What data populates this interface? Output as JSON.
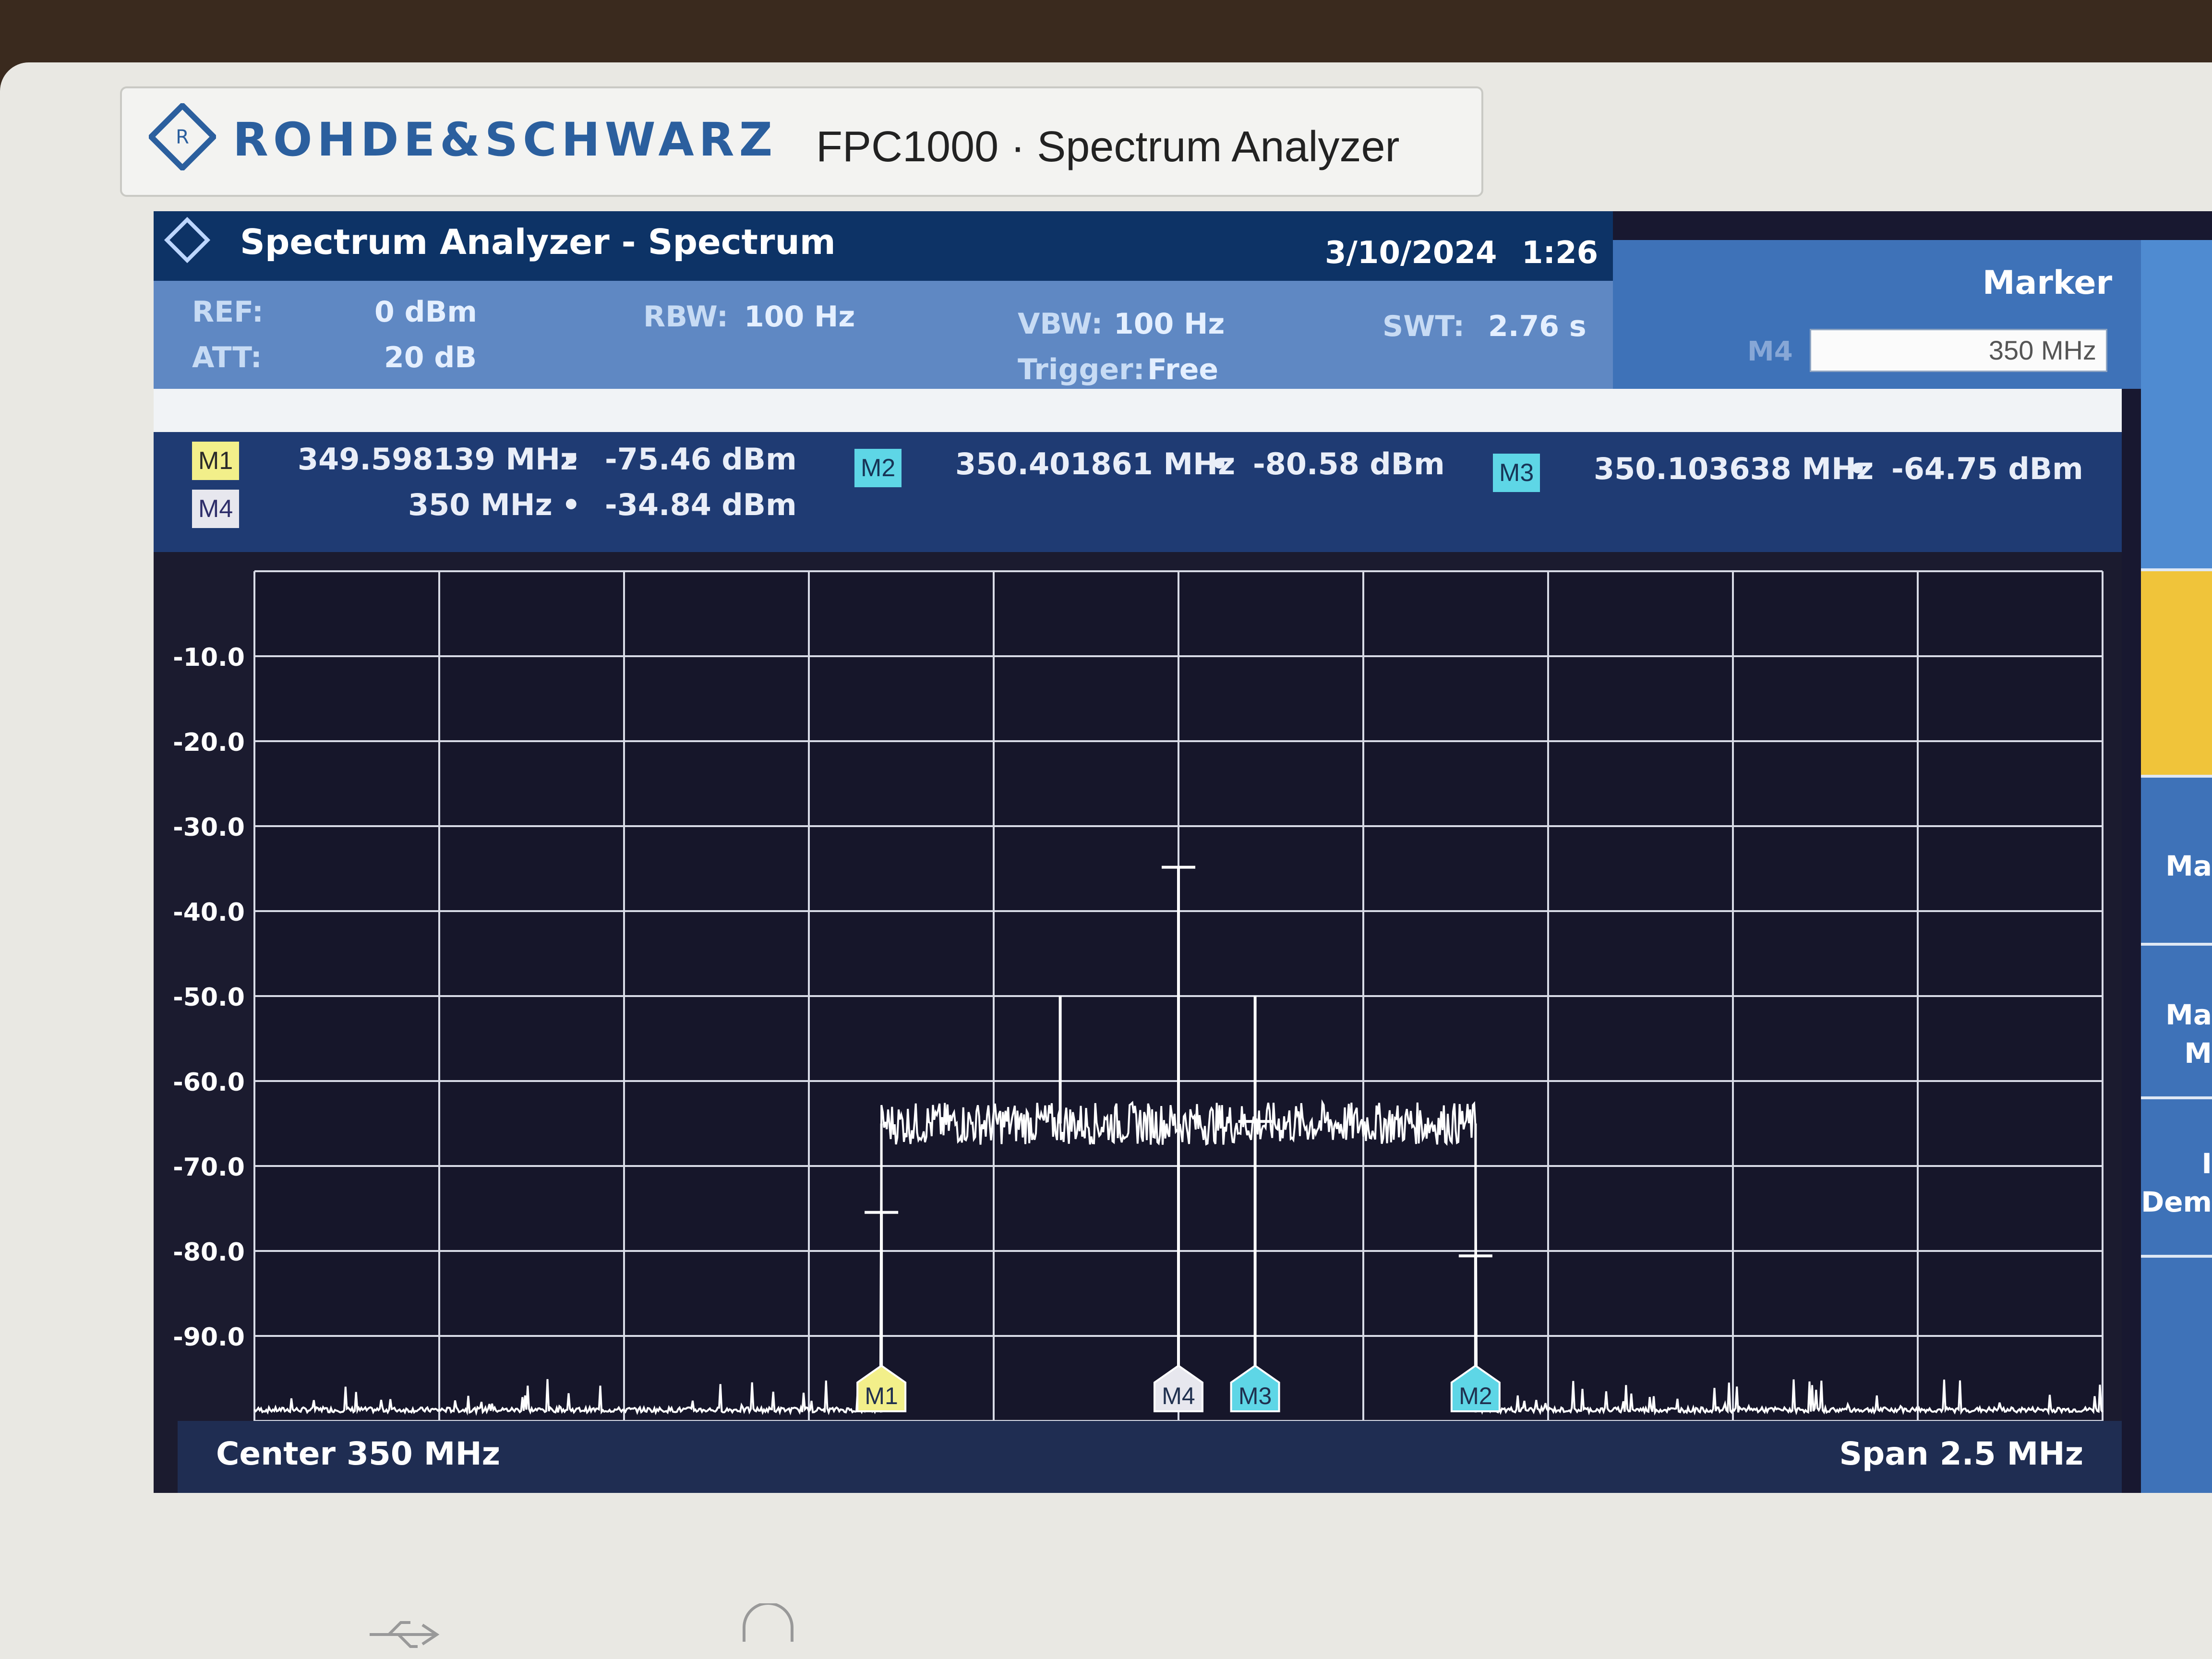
{
  "device": {
    "brand": "ROHDE&SCHWARZ",
    "model": "FPC1000 · Spectrum Analyzer"
  },
  "header": {
    "title": "Spectrum Analyzer - Spectrum",
    "date": "3/10/2024",
    "time": "1:26"
  },
  "settings": {
    "ref_label": "REF:",
    "ref_value": "0 dBm",
    "att_label": "ATT:",
    "att_value": "20 dB",
    "rbw_label": "RBW:",
    "rbw_value": "100 Hz",
    "vbw_label": "VBW:",
    "vbw_value": "100 Hz",
    "trigger_label": "Trigger:",
    "trigger_value": "Free",
    "swt_label": "SWT:",
    "swt_value": "2.76 s"
  },
  "marker_panel": {
    "title": "Marker",
    "field_label": "M4",
    "field_value": "350 MHz"
  },
  "softkeys": {
    "item1": "Ma",
    "item2a": "Ma",
    "item2b": "M",
    "item3a": "I",
    "item3b": "Dem"
  },
  "markers": [
    {
      "tag": "M1",
      "freq": "349.598139 MHz",
      "level": "-75.46 dBm"
    },
    {
      "tag": "M2",
      "freq": "350.401861 MHz",
      "level": "-80.58 dBm"
    },
    {
      "tag": "M3",
      "freq": "350.103638 MHz",
      "level": "-64.75 dBm"
    },
    {
      "tag": "M4",
      "freq": "350 MHz",
      "level": "-34.84 dBm"
    }
  ],
  "marker_separator": "•",
  "chart_data": {
    "type": "line",
    "xlabel": "",
    "ylabel": "",
    "ylim": [
      -100,
      0
    ],
    "xlim_mhz": [
      348.75,
      351.25
    ],
    "y_ticks": [
      "-10.0",
      "-20.0",
      "-30.0",
      "-40.0",
      "-50.0",
      "-60.0",
      "-70.0",
      "-80.0",
      "-90.0"
    ],
    "grid": true,
    "noise_band": {
      "start_mhz": 349.598139,
      "end_mhz": 350.401861,
      "level_dbm": -65
    },
    "noise_floor_dbm": -99,
    "spurs": [
      {
        "freq_mhz": 349.84,
        "level_dbm": -50
      },
      {
        "freq_mhz": 350.103638,
        "level_dbm": -50
      }
    ],
    "series": [
      {
        "name": "",
        "x": [
          349.598139,
          350.0,
          350.103638,
          350.401861
        ],
        "values": [
          -75.46,
          -34.84,
          -64.75,
          -80.58
        ]
      }
    ],
    "markers": [
      {
        "label": "M1",
        "freq_mhz": 349.598139,
        "level_dbm": -75.46,
        "color": "#f2ef8a"
      },
      {
        "label": "M4",
        "freq_mhz": 350.0,
        "level_dbm": -34.84,
        "color": "#e7e7ee"
      },
      {
        "label": "M3",
        "freq_mhz": 350.103638,
        "level_dbm": -64.75,
        "color": "#5ed6e6"
      },
      {
        "label": "M2",
        "freq_mhz": 350.401861,
        "level_dbm": -80.58,
        "color": "#5ed6e6"
      }
    ]
  },
  "footer": {
    "center": "Center 350 MHz",
    "span": "Span 2.5 MHz"
  },
  "colors": {
    "accent_blue": "#0d3366",
    "panel_blue": "#5f88c3",
    "trace": "#ffffff",
    "grid": "#d8dbe6"
  }
}
